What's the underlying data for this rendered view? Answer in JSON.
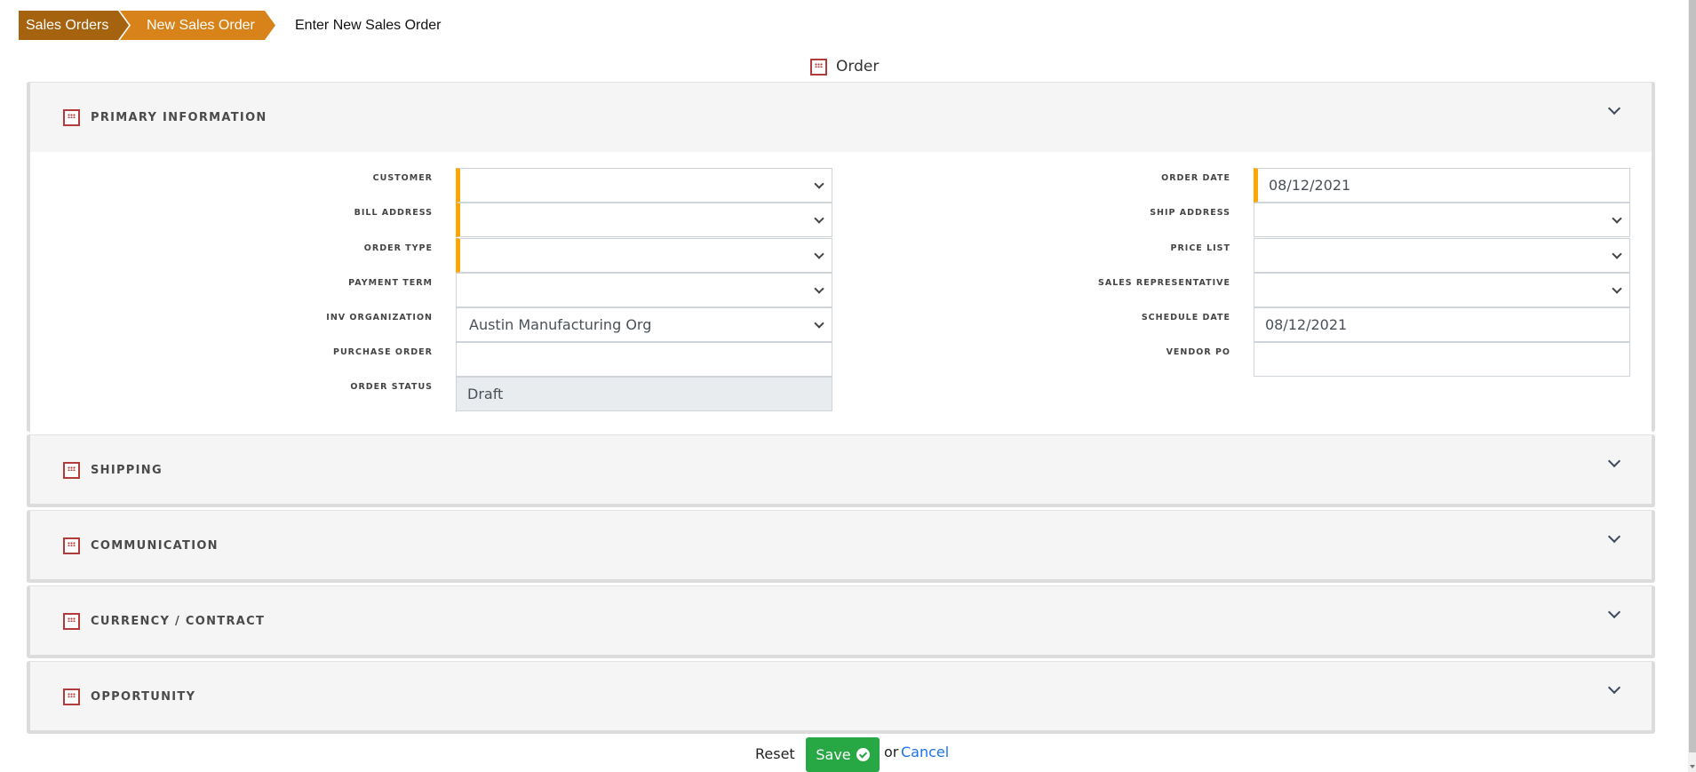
{
  "breadcrumb": {
    "items": [
      "Sales Orders",
      "New Sales Order"
    ],
    "current": "Enter New Sales Order",
    "colors": {
      "first": "#a5620f",
      "second": "#d8821a"
    }
  },
  "form_title": "Order",
  "sections": {
    "primary": {
      "title": "PRIMARY  INFORMATION",
      "left_fields": [
        {
          "label": "CUSTOMER",
          "value": "",
          "type": "select",
          "required": true
        },
        {
          "label": "BILL ADDRESS",
          "value": "",
          "type": "select",
          "required": true
        },
        {
          "label": "ORDER TYPE",
          "value": "",
          "type": "select",
          "required": true
        },
        {
          "label": "PAYMENT TERM",
          "value": "",
          "type": "select",
          "required": false
        },
        {
          "label": "INV ORGANIZATION",
          "value": "Austin Manufacturing Org",
          "type": "select",
          "required": false
        },
        {
          "label": "PURCHASE ORDER",
          "value": "",
          "type": "text",
          "required": false
        },
        {
          "label": "ORDER STATUS",
          "value": "Draft",
          "type": "readonly",
          "required": false
        }
      ],
      "right_fields": [
        {
          "label": "ORDER DATE",
          "value": "08/12/2021",
          "type": "date",
          "required": true
        },
        {
          "label": "SHIP ADDRESS",
          "value": "",
          "type": "select",
          "required": false
        },
        {
          "label": "PRICE LIST",
          "value": "",
          "type": "select",
          "required": false
        },
        {
          "label": "SALES REPRESENTATIVE",
          "value": "",
          "type": "select",
          "required": false
        },
        {
          "label": "SCHEDULE DATE",
          "value": "08/12/2021",
          "type": "date",
          "required": false
        },
        {
          "label": "VENDOR PO",
          "value": "",
          "type": "text",
          "required": false
        }
      ]
    },
    "shipping": {
      "title": "SHIPPING"
    },
    "communication": {
      "title": "COMMUNICATION"
    },
    "currency": {
      "title": "CURRENCY  /  CONTRACT"
    },
    "opportunity": {
      "title": "OPPORTUNITY"
    }
  },
  "footer": {
    "reset_label": "Reset",
    "save_label": "Save",
    "or_text": "or",
    "cancel_label": "Cancel"
  },
  "colors": {
    "required_marker": "#ffa500",
    "save_button": "#28a745",
    "cancel_link": "#1a73e8",
    "section_icon": "#b23b3b"
  }
}
